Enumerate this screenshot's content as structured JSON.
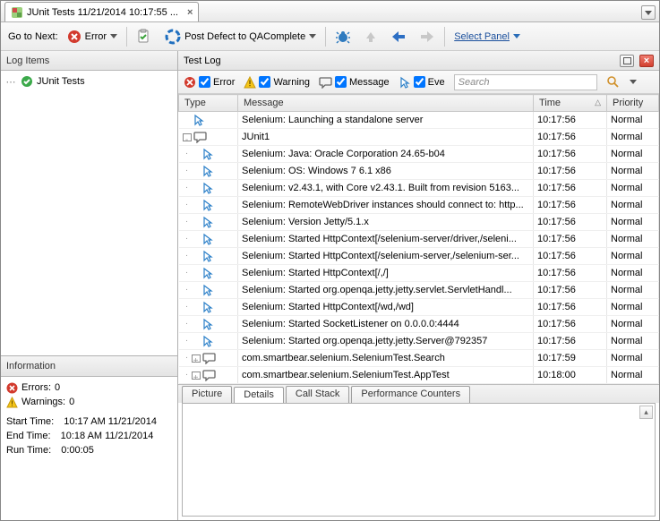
{
  "tab": {
    "icon": "junit-icon",
    "title": "JUnit Tests 11/21/2014 10:17:55 ...",
    "close": "×"
  },
  "toolbar": {
    "goto_label": "Go to Next:",
    "error_label": "Error",
    "post_defect_label": "Post Defect to QAComplete",
    "select_panel_label": "Select Panel"
  },
  "left": {
    "title": "Log Items",
    "tree_root": "JUnit Tests"
  },
  "info": {
    "title": "Information",
    "errors_label": "Errors:",
    "errors_value": "0",
    "warnings_label": "Warnings:",
    "warnings_value": "0",
    "start_label": "Start Time:",
    "start_value": "10:17 AM 11/21/2014",
    "end_label": "End Time:",
    "end_value": "10:18 AM 11/21/2014",
    "run_label": "Run Time:",
    "run_value": "0:00:05"
  },
  "testlog": {
    "title": "Test Log",
    "filters": {
      "error_label": "Error",
      "warning_label": "Warning",
      "message_label": "Message",
      "event_label": "Eve",
      "search_placeholder": "Search"
    },
    "columns": {
      "type": "Type",
      "message": "Message",
      "time": "Time",
      "priority": "Priority"
    },
    "rows": [
      {
        "depth": 0,
        "expander": "",
        "icon": "cursor",
        "message": "Selenium: Launching a standalone server",
        "time": "10:17:56",
        "priority": "Normal"
      },
      {
        "depth": 0,
        "expander": "-",
        "icon": "bubble",
        "message": "JUnit1",
        "time": "10:17:56",
        "priority": "Normal"
      },
      {
        "depth": 1,
        "expander": "",
        "icon": "cursor",
        "message": "Selenium: Java: Oracle Corporation 24.65-b04",
        "time": "10:17:56",
        "priority": "Normal"
      },
      {
        "depth": 1,
        "expander": "",
        "icon": "cursor",
        "message": "Selenium: OS: Windows 7 6.1 x86",
        "time": "10:17:56",
        "priority": "Normal"
      },
      {
        "depth": 1,
        "expander": "",
        "icon": "cursor",
        "message": "Selenium: v2.43.1, with Core v2.43.1. Built from revision 5163...",
        "time": "10:17:56",
        "priority": "Normal"
      },
      {
        "depth": 1,
        "expander": "",
        "icon": "cursor",
        "message": "Selenium: RemoteWebDriver instances should connect to: http...",
        "time": "10:17:56",
        "priority": "Normal"
      },
      {
        "depth": 1,
        "expander": "",
        "icon": "cursor",
        "message": "Selenium: Version Jetty/5.1.x",
        "time": "10:17:56",
        "priority": "Normal"
      },
      {
        "depth": 1,
        "expander": "",
        "icon": "cursor",
        "message": "Selenium: Started HttpContext[/selenium-server/driver,/seleni...",
        "time": "10:17:56",
        "priority": "Normal"
      },
      {
        "depth": 1,
        "expander": "",
        "icon": "cursor",
        "message": "Selenium: Started HttpContext[/selenium-server,/selenium-ser...",
        "time": "10:17:56",
        "priority": "Normal"
      },
      {
        "depth": 1,
        "expander": "",
        "icon": "cursor",
        "message": "Selenium: Started HttpContext[/,/]",
        "time": "10:17:56",
        "priority": "Normal"
      },
      {
        "depth": 1,
        "expander": "",
        "icon": "cursor",
        "message": "Selenium: Started org.openqa.jetty.jetty.servlet.ServletHandl...",
        "time": "10:17:56",
        "priority": "Normal"
      },
      {
        "depth": 1,
        "expander": "",
        "icon": "cursor",
        "message": "Selenium: Started HttpContext[/wd,/wd]",
        "time": "10:17:56",
        "priority": "Normal"
      },
      {
        "depth": 1,
        "expander": "",
        "icon": "cursor",
        "message": "Selenium: Started SocketListener on 0.0.0.0:4444",
        "time": "10:17:56",
        "priority": "Normal"
      },
      {
        "depth": 1,
        "expander": "",
        "icon": "cursor",
        "message": "Selenium: Started org.openqa.jetty.jetty.Server@792357",
        "time": "10:17:56",
        "priority": "Normal"
      },
      {
        "depth": 1,
        "expander": "+",
        "icon": "bubble",
        "message": "com.smartbear.selenium.SeleniumTest.Search",
        "time": "10:17:59",
        "priority": "Normal"
      },
      {
        "depth": 1,
        "expander": "+",
        "icon": "bubble",
        "message": "com.smartbear.selenium.SeleniumTest.AppTest",
        "time": "10:18:00",
        "priority": "Normal"
      }
    ],
    "bottom_tabs": {
      "picture": "Picture",
      "details": "Details",
      "callstack": "Call Stack",
      "perf": "Performance Counters"
    }
  }
}
